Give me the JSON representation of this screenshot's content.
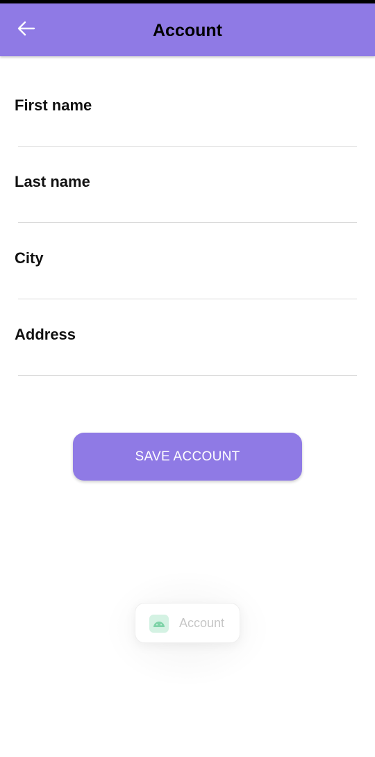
{
  "header": {
    "title": "Account",
    "back_icon": "arrow-left-icon"
  },
  "form": {
    "fields": [
      {
        "label": "First name",
        "value": ""
      },
      {
        "label": "Last name",
        "value": ""
      },
      {
        "label": "City",
        "value": ""
      },
      {
        "label": "Address",
        "value": ""
      }
    ]
  },
  "actions": {
    "save_label": "SAVE ACCOUNT"
  },
  "toast": {
    "label": "Account",
    "icon": "android-icon"
  },
  "colors": {
    "accent": "#8f7ae5",
    "divider": "#d9d9d9",
    "toast_icon_bg": "#d4f2e3",
    "toast_icon_fg": "#7fd3a8"
  }
}
